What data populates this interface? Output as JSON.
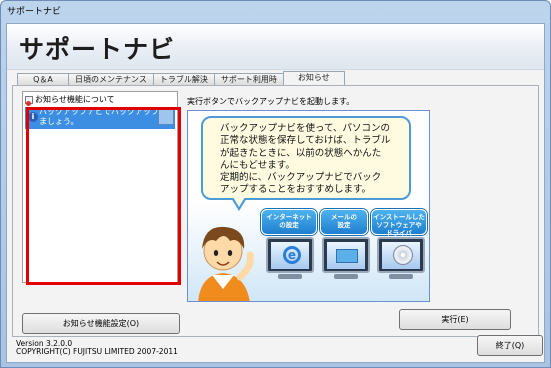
{
  "window": {
    "title": "サポートナビ"
  },
  "header": {
    "title": "サポートナビ"
  },
  "tabs": [
    {
      "label": "Q＆A"
    },
    {
      "label": "日頃のメンテナンス"
    },
    {
      "label": "トラブル解決"
    },
    {
      "label": "サポート利用時"
    },
    {
      "label": "お知らせ",
      "active": true
    }
  ],
  "notice_list": {
    "items": [
      {
        "label": "お知らせ機能について"
      },
      {
        "label_line1": "バックアップナビでバックアップし",
        "label_line2": "ましょう。",
        "selected": true
      }
    ]
  },
  "buttons": {
    "settings_label": "お知らせ機能設定(O)",
    "run_label": "実行(E)",
    "exit_label": "終了(Q)"
  },
  "detail": {
    "instruction": "実行ボタンでバックアップナビを起動します。",
    "bubble_lines": [
      "バックアップナビを使って、パソコンの",
      "正常な状態を保存しておけば、トラブル",
      "が起きたときに、以前の状態へかんた",
      "んにもどせます。",
      "定期的に、バックアップナビでバック",
      "アップすることをおすすめします。"
    ],
    "badges": [
      {
        "line1": "インターネット",
        "line2": "の設定",
        "icon": "ie-icon"
      },
      {
        "line1": "メールの",
        "line2": "設定",
        "icon": "mail-icon"
      },
      {
        "line1": "インストールした",
        "line2": "ソフトウェアや",
        "line3": "ドライバ",
        "icon": "cd-icon"
      }
    ]
  },
  "footer": {
    "version": "Version 3.2.0.0",
    "copyright": "COPYRIGHT(C) FUJITSU LIMITED 2007-2011"
  },
  "colors": {
    "highlight_frame": "#e00000",
    "selection": "#3c8ee3",
    "bubble_border": "#4d9bd6"
  }
}
